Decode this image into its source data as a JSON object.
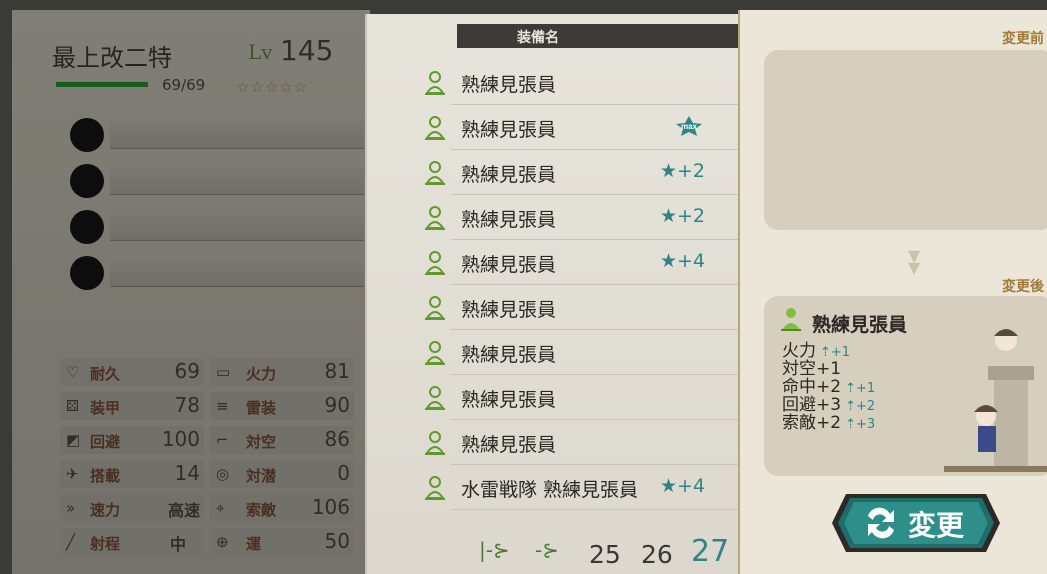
{
  "ship": {
    "name": "最上改二特",
    "level_label": "Lv",
    "level": "145",
    "hp": "69/69",
    "stars": "☆☆☆☆☆",
    "stats": [
      {
        "label": "耐久",
        "value": "69",
        "label2": "火力",
        "value2": "81"
      },
      {
        "label": "装甲",
        "value": "78",
        "label2": "雷装",
        "value2": "90"
      },
      {
        "label": "回避",
        "value": "100",
        "label2": "対空",
        "value2": "86"
      },
      {
        "label": "搭載",
        "value": "14",
        "label2": "対潜",
        "value2": "0"
      },
      {
        "label": "速力",
        "value": "高速",
        "label2": "索敵",
        "value2": "106"
      },
      {
        "label": "射程",
        "value": "中",
        "label2": "運",
        "value2": "50"
      }
    ]
  },
  "list": {
    "header": "装備名",
    "items": [
      {
        "name": "熟練見張員",
        "prof": ""
      },
      {
        "name": "熟練見張員",
        "prof": "max"
      },
      {
        "name": "熟練見張員",
        "prof": "★+2"
      },
      {
        "name": "熟練見張員",
        "prof": "★+2"
      },
      {
        "name": "熟練見張員",
        "prof": "★+4"
      },
      {
        "name": "熟練見張員",
        "prof": ""
      },
      {
        "name": "熟練見張員",
        "prof": ""
      },
      {
        "name": "熟練見張員",
        "prof": ""
      },
      {
        "name": "熟練見張員",
        "prof": ""
      },
      {
        "name": "水雷戦隊 熟練見張員",
        "prof": "★+4"
      }
    ],
    "pages": [
      "25",
      "26",
      "27"
    ],
    "current_page": "27"
  },
  "detail": {
    "before_label": "変更前",
    "after_label": "変更後",
    "after_name": "熟練見張員",
    "bonuses": [
      {
        "text": "火力",
        "up": "+1"
      },
      {
        "text": "対空+1",
        "up": ""
      },
      {
        "text": "命中+2",
        "up": "+1"
      },
      {
        "text": "回避+3",
        "up": "+2"
      },
      {
        "text": "索敵+2",
        "up": "+3"
      }
    ],
    "change_label": "変更"
  },
  "colors": {
    "accent": "#2f8585",
    "hp": "#1f6d1f",
    "button": "#1f6d6a"
  }
}
